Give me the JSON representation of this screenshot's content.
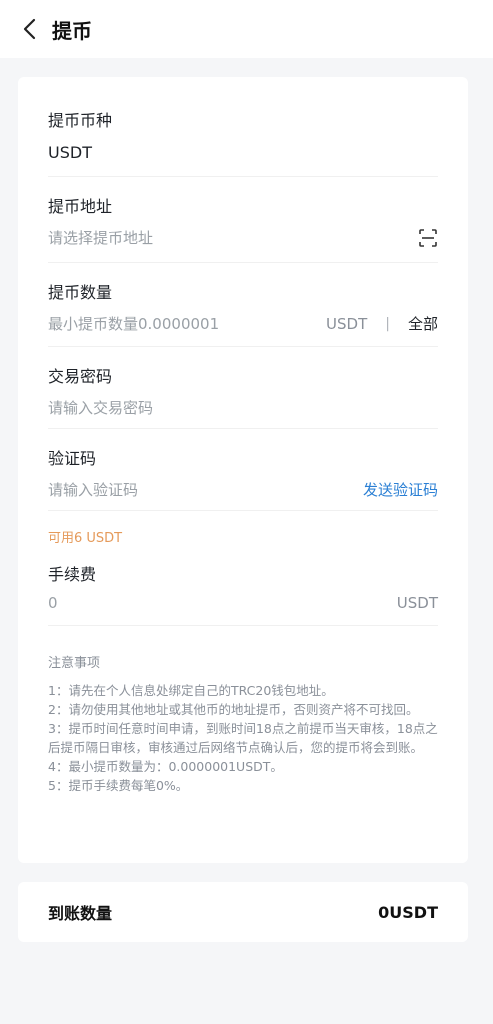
{
  "header": {
    "title": "提币"
  },
  "coin": {
    "label": "提币币种",
    "value": "USDT"
  },
  "address": {
    "label": "提币地址",
    "placeholder": "请选择提币地址"
  },
  "amount": {
    "label": "提币数量",
    "placeholder": "最小提币数量0.0000001",
    "unit": "USDT",
    "separator": "|",
    "all": "全部"
  },
  "password": {
    "label": "交易密码",
    "placeholder": "请输入交易密码"
  },
  "code": {
    "label": "验证码",
    "placeholder": "请输入验证码",
    "send": "发送验证码"
  },
  "available": {
    "text": "可用6  USDT"
  },
  "fee": {
    "label": "手续费",
    "value": "0",
    "unit": "USDT"
  },
  "notes": {
    "title": "注意事项",
    "items": [
      "1：请先在个人信息处绑定自己的TRC20钱包地址。",
      "2：请勿使用其他地址或其他币的地址提币，否则资产将不可找回。",
      "3：提币时间任意时间申请，到账时间18点之前提币当天审核，18点之后提币隔日审核，审核通过后网络节点确认后，您的提币将会到账。",
      "4：最小提币数量为：0.0000001USDT。",
      "5：提币手续费每笔0%。"
    ]
  },
  "arrival": {
    "label": "到账数量",
    "value": "0USDT"
  },
  "colors": {
    "accent_blue": "#2a7fd4",
    "available_orange": "#e59a5a",
    "background": "#f5f6f8"
  }
}
